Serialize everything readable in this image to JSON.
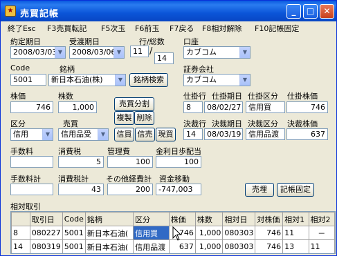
{
  "window": {
    "title": "売買記帳",
    "icon_glyph": "★",
    "minimize": "_",
    "maximize": "□",
    "close": "✕"
  },
  "menu": [
    "終了Esc",
    "F3売買転記",
    "F5次玉",
    "F6前玉",
    "F7戻る",
    "F8相対解除",
    "F10記帳固定"
  ],
  "form": {
    "yakujo_label": "約定期日",
    "yakujo_value": "2008/03/03",
    "ukewatashi_label": "受渡期日",
    "ukewatashi_value": "2008/03/06",
    "gyo_label": "行/総数",
    "gyo_value": "11",
    "total_value": "14",
    "koza_label": "口座",
    "koza_value": "カブコム",
    "code_label": "Code",
    "code_value": "5001",
    "meigara_label": "銘柄",
    "meigara_value": "新日本石油(株)",
    "search_button": "銘柄検索",
    "shoken_label": "証券会社",
    "shoken_value": "カブコム",
    "kabuka_label": "株価",
    "kabuka_value": "746",
    "kabusu_label": "株数",
    "kabusu_value": "1,000",
    "split_button": "売買分割",
    "copy_button": "複製",
    "delete_button": "削除",
    "kubun_label": "区分",
    "kubun_value": "信用",
    "baibai_label": "売買",
    "baibai_value": "信用品受",
    "shinbai_button": "信買",
    "shinuri_button": "信売",
    "genbai_button": "現買",
    "tesuryo_label": "手数料",
    "tesuryo_value": "",
    "shohizei_label": "消費税",
    "shohizei_value": "5",
    "kanrihi_label": "管理費",
    "kanrihi_value": "100",
    "kinri_label": "金利日歩配当",
    "kinri_value": "100",
    "tesuryokei_label": "手数料計",
    "tesuryokei_value": "",
    "shohizeikei_label": "消費税計",
    "shohizeikei_value": "43",
    "sonotakei_label": "その他経費計",
    "sonotakei_value": "200",
    "shikin_label": "資金移動",
    "shikin_value": "-747,003",
    "shikake": {
      "gyo_label": "仕掛行",
      "gyo_value": "8",
      "date_label": "仕掛期日",
      "date_value": "08/02/27",
      "kubun_label": "仕掛区分",
      "kubun_value": "信用買",
      "price_label": "仕掛株価",
      "price_value": "746"
    },
    "kessai": {
      "gyo_label": "決裁行",
      "gyo_value": "14",
      "date_label": "決裁期日",
      "date_value": "08/03/19",
      "kubun_label": "決裁区分",
      "kubun_value": "信用品渡",
      "price_label": "決裁株価",
      "price_value": "637"
    },
    "baiten_button": "売埋",
    "kichokotei_button": "記帳固定"
  },
  "table": {
    "section_label": "相対取引",
    "headers": [
      "",
      "取引日",
      "Code",
      "銘柄",
      "区分",
      "株価",
      "株数",
      "相対日",
      "対株価",
      "相対1",
      "相対2"
    ],
    "rows": [
      [
        "8",
        "080227",
        "5001",
        "新日本石油(",
        "信用買",
        "746",
        "1,000",
        "080303",
        "746",
        "11",
        "－"
      ],
      [
        "14",
        "080319",
        "5001",
        "新日本石油(",
        "信用品渡",
        "637",
        "1,000",
        "080303",
        "746",
        "13",
        "11"
      ]
    ]
  }
}
